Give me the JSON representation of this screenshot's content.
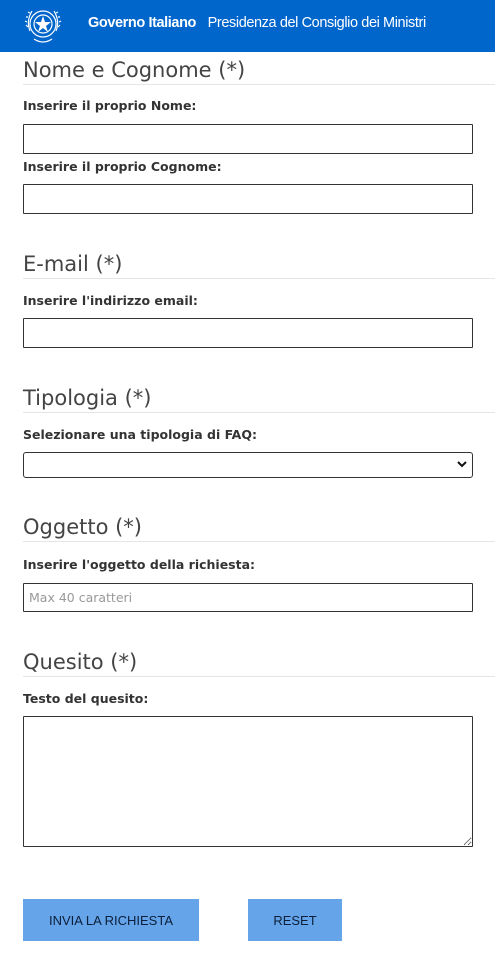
{
  "header": {
    "gov_label": "Governo Italiano",
    "org_label": "Presidenza del Consiglio dei Ministri",
    "brand_color": "#0066cc"
  },
  "form": {
    "name_section": {
      "legend": "Nome e Cognome (*)",
      "first_name_label": "Inserire il proprio Nome:",
      "first_name_value": "",
      "last_name_label": "Inserire il proprio Cognome:",
      "last_name_value": ""
    },
    "email_section": {
      "legend": "E-mail (*)",
      "email_label": "Inserire l'indirizzo email:",
      "email_value": ""
    },
    "type_section": {
      "legend": "Tipologia (*)",
      "type_label": "Selezionare una tipologia di FAQ:",
      "selected_value": ""
    },
    "subject_section": {
      "legend": "Oggetto (*)",
      "subject_label": "Inserire l'oggetto della richiesta:",
      "subject_placeholder": "Max 40 caratteri",
      "subject_value": ""
    },
    "question_section": {
      "legend": "Quesito (*)",
      "question_label": "Testo del quesito:",
      "question_value": ""
    },
    "buttons": {
      "submit_label": "INVIA LA RICHIESTA",
      "reset_label": "RESET",
      "button_color": "#65a4e9"
    }
  }
}
